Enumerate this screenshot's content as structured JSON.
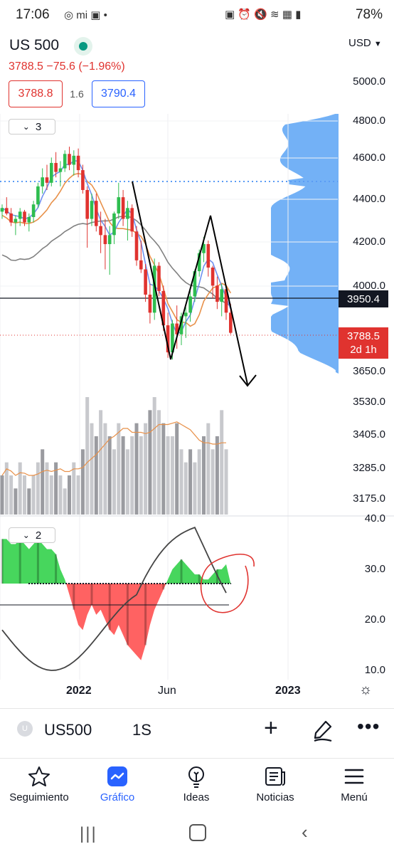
{
  "status_bar": {
    "time": "17:06",
    "right_text": "78%"
  },
  "header": {
    "symbol": "US 500",
    "price_change": "3788.5  −75.6 (−1.96%)",
    "bid": "3788.8",
    "spread": "1.6",
    "ask": "3790.4",
    "currency": "USD"
  },
  "price_axis": [
    "5000.0",
    "4800.0",
    "4600.0",
    "4400.0",
    "4200.0",
    "4000.0",
    "3650.0",
    "3530.0",
    "3405.0",
    "3285.0",
    "3175.0"
  ],
  "price_tags": {
    "crosshair": "3950.4",
    "last": "3788.5",
    "countdown": "2d 1h"
  },
  "indicator_counts": {
    "main": "3",
    "oscillator": "2"
  },
  "oscillator_axis": [
    "40.0",
    "30.0",
    "20.0",
    "10.0"
  ],
  "time_axis": [
    "2022",
    "Jun",
    "2023"
  ],
  "toolbar": {
    "symbol": "US500",
    "timeframe": "1S",
    "avatar": "U"
  },
  "nav": [
    {
      "label": "Seguimiento",
      "icon": "star-icon"
    },
    {
      "label": "Gráfico",
      "icon": "chart-icon",
      "active": true
    },
    {
      "label": "Ideas",
      "icon": "lightbulb-icon"
    },
    {
      "label": "Noticias",
      "icon": "news-icon"
    },
    {
      "label": "Menú",
      "icon": "menu-icon"
    }
  ],
  "colors": {
    "up": "#2ebd4f",
    "down": "#e0332f",
    "volume_profile": "#5ba3f5",
    "accent": "#2962ff"
  },
  "chart_data": {
    "type": "candlestick",
    "price_range": [
      3600,
      5000
    ],
    "candles": [
      {
        "o": 4460,
        "h": 4500,
        "l": 4420,
        "c": 4480
      },
      {
        "o": 4480,
        "h": 4540,
        "l": 4440,
        "c": 4450
      },
      {
        "o": 4450,
        "h": 4480,
        "l": 4380,
        "c": 4400
      },
      {
        "o": 4400,
        "h": 4440,
        "l": 4330,
        "c": 4420
      },
      {
        "o": 4420,
        "h": 4480,
        "l": 4380,
        "c": 4460
      },
      {
        "o": 4460,
        "h": 4470,
        "l": 4380,
        "c": 4400
      },
      {
        "o": 4400,
        "h": 4450,
        "l": 4350,
        "c": 4430
      },
      {
        "o": 4430,
        "h": 4520,
        "l": 4400,
        "c": 4500
      },
      {
        "o": 4500,
        "h": 4620,
        "l": 4480,
        "c": 4600
      },
      {
        "o": 4600,
        "h": 4700,
        "l": 4560,
        "c": 4650
      },
      {
        "o": 4650,
        "h": 4720,
        "l": 4580,
        "c": 4620
      },
      {
        "o": 4620,
        "h": 4760,
        "l": 4600,
        "c": 4730
      },
      {
        "o": 4730,
        "h": 4790,
        "l": 4650,
        "c": 4680
      },
      {
        "o": 4680,
        "h": 4740,
        "l": 4600,
        "c": 4700
      },
      {
        "o": 4700,
        "h": 4800,
        "l": 4680,
        "c": 4780
      },
      {
        "o": 4780,
        "h": 4820,
        "l": 4690,
        "c": 4720
      },
      {
        "o": 4720,
        "h": 4800,
        "l": 4660,
        "c": 4770
      },
      {
        "o": 4770,
        "h": 4810,
        "l": 4650,
        "c": 4690
      },
      {
        "o": 4690,
        "h": 4720,
        "l": 4560,
        "c": 4580
      },
      {
        "o": 4580,
        "h": 4600,
        "l": 4260,
        "c": 4420
      },
      {
        "o": 4420,
        "h": 4560,
        "l": 4380,
        "c": 4520
      },
      {
        "o": 4520,
        "h": 4560,
        "l": 4350,
        "c": 4380
      },
      {
        "o": 4380,
        "h": 4460,
        "l": 4230,
        "c": 4330
      },
      {
        "o": 4330,
        "h": 4420,
        "l": 4140,
        "c": 4280
      },
      {
        "o": 4280,
        "h": 4380,
        "l": 4110,
        "c": 4330
      },
      {
        "o": 4330,
        "h": 4460,
        "l": 4280,
        "c": 4450
      },
      {
        "o": 4450,
        "h": 4620,
        "l": 4420,
        "c": 4540
      },
      {
        "o": 4540,
        "h": 4580,
        "l": 4380,
        "c": 4420
      },
      {
        "o": 4420,
        "h": 4520,
        "l": 4300,
        "c": 4480
      },
      {
        "o": 4480,
        "h": 4500,
        "l": 4320,
        "c": 4350
      },
      {
        "o": 4350,
        "h": 4380,
        "l": 4160,
        "c": 4190
      },
      {
        "o": 4190,
        "h": 4300,
        "l": 4120,
        "c": 4140
      },
      {
        "o": 4140,
        "h": 4170,
        "l": 3960,
        "c": 4000
      },
      {
        "o": 4000,
        "h": 4060,
        "l": 3840,
        "c": 3900
      },
      {
        "o": 3900,
        "h": 4200,
        "l": 3860,
        "c": 4160
      },
      {
        "o": 4160,
        "h": 4180,
        "l": 3990,
        "c": 4020
      },
      {
        "o": 4020,
        "h": 4050,
        "l": 3800,
        "c": 3830
      },
      {
        "o": 3830,
        "h": 3900,
        "l": 3650,
        "c": 3680
      },
      {
        "o": 3680,
        "h": 3860,
        "l": 3640,
        "c": 3840
      },
      {
        "o": 3840,
        "h": 3940,
        "l": 3700,
        "c": 3780
      },
      {
        "o": 3780,
        "h": 3900,
        "l": 3720,
        "c": 3880
      },
      {
        "o": 3880,
        "h": 3930,
        "l": 3760,
        "c": 3900
      },
      {
        "o": 3900,
        "h": 4020,
        "l": 3850,
        "c": 3990
      },
      {
        "o": 3990,
        "h": 4140,
        "l": 3960,
        "c": 4130
      },
      {
        "o": 4130,
        "h": 4250,
        "l": 4100,
        "c": 4230
      },
      {
        "o": 4230,
        "h": 4320,
        "l": 4180,
        "c": 4280
      },
      {
        "o": 4280,
        "h": 4300,
        "l": 4100,
        "c": 4150
      },
      {
        "o": 4150,
        "h": 4160,
        "l": 3980,
        "c": 4050
      },
      {
        "o": 4050,
        "h": 4100,
        "l": 3920,
        "c": 3960
      },
      {
        "o": 3960,
        "h": 4060,
        "l": 3880,
        "c": 4030
      },
      {
        "o": 4030,
        "h": 4040,
        "l": 3860,
        "c": 3900
      },
      {
        "o": 3900,
        "h": 3950,
        "l": 3780,
        "c": 3788.5
      }
    ],
    "volume": [
      3,
      4,
      3,
      2,
      4,
      3,
      2,
      3,
      4,
      5,
      4,
      3,
      4,
      3,
      2,
      3,
      4,
      3,
      5,
      9,
      7,
      6,
      8,
      7,
      6,
      5,
      7,
      6,
      5,
      6,
      7,
      6,
      7,
      8,
      9,
      8,
      7,
      6,
      6,
      7,
      5,
      4,
      5,
      4,
      5,
      6,
      7,
      5,
      6,
      8,
      5
    ],
    "oscillator": [
      36,
      36,
      35,
      35,
      36,
      35,
      34,
      35,
      36,
      35,
      34,
      34,
      33,
      30,
      28,
      25,
      22,
      19,
      18,
      21,
      23,
      21,
      22,
      20,
      18,
      17,
      19,
      17,
      15,
      14,
      13,
      12,
      15,
      19,
      22,
      24,
      26,
      28,
      30,
      31,
      32,
      31,
      30,
      29,
      29,
      28,
      28,
      29,
      30,
      30,
      31
    ]
  }
}
